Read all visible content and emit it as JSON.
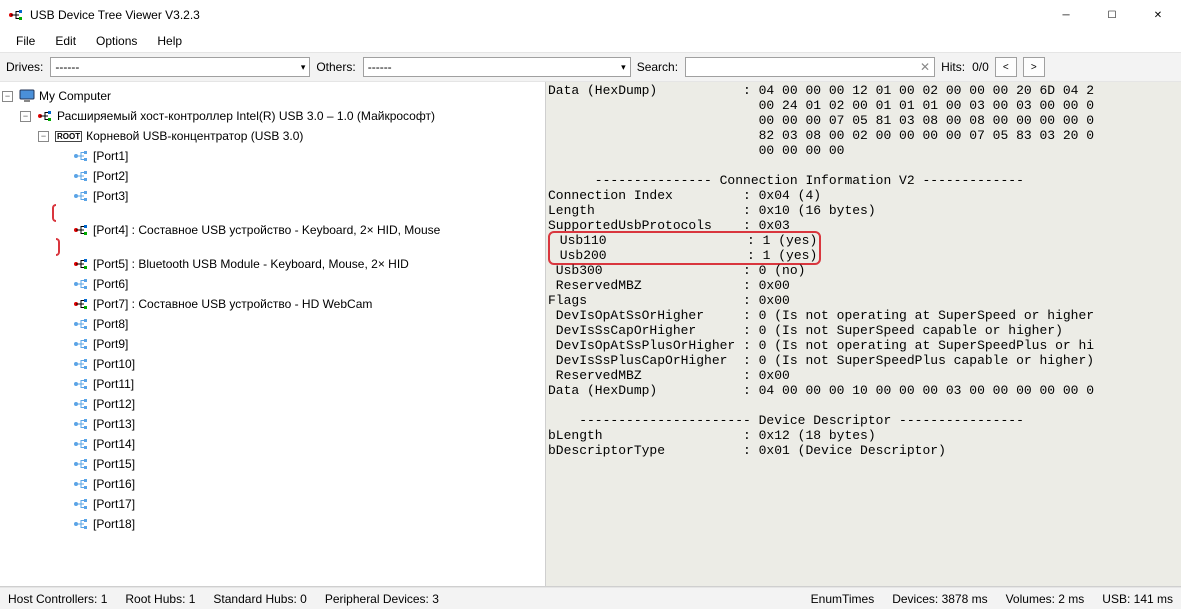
{
  "window": {
    "title": "USB Device Tree Viewer V3.2.3"
  },
  "menu": {
    "file": "File",
    "edit": "Edit",
    "options": "Options",
    "help": "Help"
  },
  "toolbar": {
    "drives_label": "Drives:",
    "drives_value": "------",
    "others_label": "Others:",
    "others_value": "------",
    "search_label": "Search:",
    "search_value": "",
    "hits_label": "Hits:",
    "hits_value": "0/0",
    "prev": "<",
    "next": ">"
  },
  "tree": {
    "root": "My Computer",
    "controller": "Расширяемый хост-контроллер Intel(R) USB 3.0 – 1.0 (Майкрософт)",
    "hub": "Корневой USB-концентратор (USB 3.0)",
    "root_badge": "ROOT",
    "ports": [
      {
        "label": "[Port1]",
        "active": false
      },
      {
        "label": "[Port2]",
        "active": false
      },
      {
        "label": "[Port3]",
        "active": false
      },
      {
        "label": "[Port4] : Составное USB устройство - Keyboard, 2× HID, Mouse",
        "active": true,
        "highlight": true
      },
      {
        "label": "[Port5] : Bluetooth USB Module - Keyboard, Mouse, 2× HID",
        "active": true
      },
      {
        "label": "[Port6]",
        "active": false
      },
      {
        "label": "[Port7] : Составное USB устройство - HD WebCam",
        "active": true
      },
      {
        "label": "[Port8]",
        "active": false
      },
      {
        "label": "[Port9]",
        "active": false
      },
      {
        "label": "[Port10]",
        "active": false
      },
      {
        "label": "[Port11]",
        "active": false
      },
      {
        "label": "[Port12]",
        "active": false
      },
      {
        "label": "[Port13]",
        "active": false
      },
      {
        "label": "[Port14]",
        "active": false
      },
      {
        "label": "[Port15]",
        "active": false
      },
      {
        "label": "[Port16]",
        "active": false
      },
      {
        "label": "[Port17]",
        "active": false
      },
      {
        "label": "[Port18]",
        "active": false
      }
    ]
  },
  "detail_lines": [
    "Data (HexDump)           : 04 00 00 00 12 01 00 02 00 00 00 20 6D 04 2",
    "                           00 24 01 02 00 01 01 01 00 03 00 03 00 00 0",
    "                           00 00 00 07 05 81 03 08 00 08 00 00 00 00 0",
    "                           82 03 08 00 02 00 00 00 00 07 05 83 03 20 0",
    "                           00 00 00 00",
    "",
    "      --------------- Connection Information V2 -------------",
    "Connection Index         : 0x04 (4)",
    "Length                   : 0x10 (16 bytes)",
    "SupportedUsbProtocols    : 0x03",
    " Usb110                  : 1 (yes)",
    " Usb200                  : 1 (yes)",
    " Usb300                  : 0 (no)",
    " ReservedMBZ             : 0x00",
    "Flags                    : 0x00",
    " DevIsOpAtSsOrHigher     : 0 (Is not operating at SuperSpeed or higher",
    " DevIsSsCapOrHigher      : 0 (Is not SuperSpeed capable or higher)",
    " DevIsOpAtSsPlusOrHigher : 0 (Is not operating at SuperSpeedPlus or hi",
    " DevIsSsPlusCapOrHigher  : 0 (Is not SuperSpeedPlus capable or higher)",
    " ReservedMBZ             : 0x00",
    "Data (HexDump)           : 04 00 00 00 10 00 00 00 03 00 00 00 00 00 0",
    "",
    "    ---------------------- Device Descriptor ----------------",
    "bLength                  : 0x12 (18 bytes)",
    "bDescriptorType          : 0x01 (Device Descriptor)"
  ],
  "detail_highlight_rows": [
    10,
    11
  ],
  "status": {
    "hc": "Host Controllers: 1",
    "rh": "Root Hubs: 1",
    "sh": "Standard Hubs: 0",
    "pd": "Peripheral Devices: 3",
    "enum_label": "EnumTimes",
    "dev": "Devices: 3878 ms",
    "vol": "Volumes: 2 ms",
    "usb": "USB: 141 ms"
  }
}
